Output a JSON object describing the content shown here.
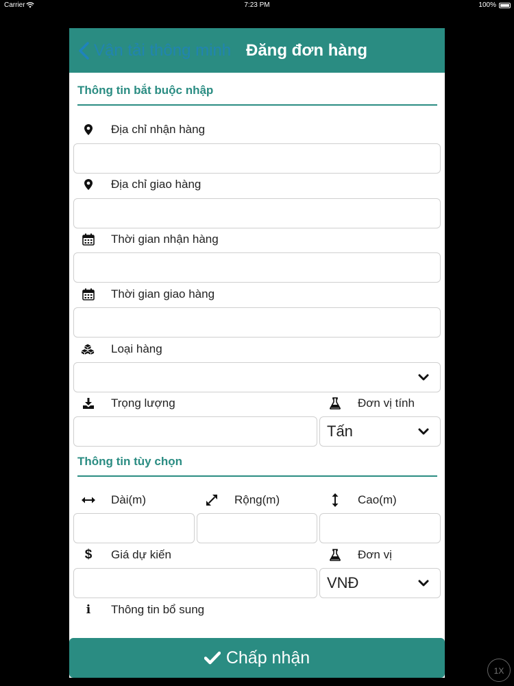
{
  "status_bar": {
    "carrier": "Carrier",
    "time": "7:23 PM",
    "battery": "100%"
  },
  "navbar": {
    "back_label": "Vận tải thông minh",
    "title": "Đăng đơn hàng"
  },
  "required_section": {
    "title": "Thông tin bắt buộc nhập",
    "pickup_address": {
      "label": "Địa chỉ nhận hàng",
      "value": ""
    },
    "delivery_address": {
      "label": "Địa chỉ giao hàng",
      "value": ""
    },
    "pickup_time": {
      "label": "Thời gian nhận hàng",
      "value": ""
    },
    "delivery_time": {
      "label": "Thời gian giao hàng",
      "value": ""
    },
    "goods_type": {
      "label": "Loại hàng",
      "value": ""
    },
    "weight": {
      "label": "Trọng lượng",
      "value": ""
    },
    "weight_unit": {
      "label": "Đơn vị tính",
      "value": "Tấn"
    }
  },
  "optional_section": {
    "title": "Thông tin tùy chọn",
    "length": {
      "label": "Dài(m)",
      "value": ""
    },
    "width": {
      "label": "Rộng(m)",
      "value": ""
    },
    "height": {
      "label": "Cao(m)",
      "value": ""
    },
    "expected_price": {
      "label": "Giá dự kiến",
      "value": ""
    },
    "price_unit": {
      "label": "Đơn vị",
      "value": "VNĐ"
    },
    "additional_info": {
      "label": "Thông tin bổ sung"
    }
  },
  "accept_button": {
    "label": "Chấp nhận"
  },
  "speed_badge": "1X",
  "colors": {
    "primary": "#2a8c82",
    "back_link": "#1a7fd6"
  },
  "icons": {
    "pickup_address": "map-marker-icon",
    "delivery_address": "map-marker-icon",
    "pickup_time": "calendar-icon",
    "delivery_time": "calendar-icon",
    "goods_type": "cubes-icon",
    "weight": "download-tray-icon",
    "weight_unit": "flask-icon",
    "length": "horizontal-arrows-icon",
    "width": "diagonal-arrows-icon",
    "height": "vertical-arrows-icon",
    "price": "dollar-icon",
    "price_unit": "flask-icon",
    "info": "info-icon",
    "accept": "check-icon"
  }
}
